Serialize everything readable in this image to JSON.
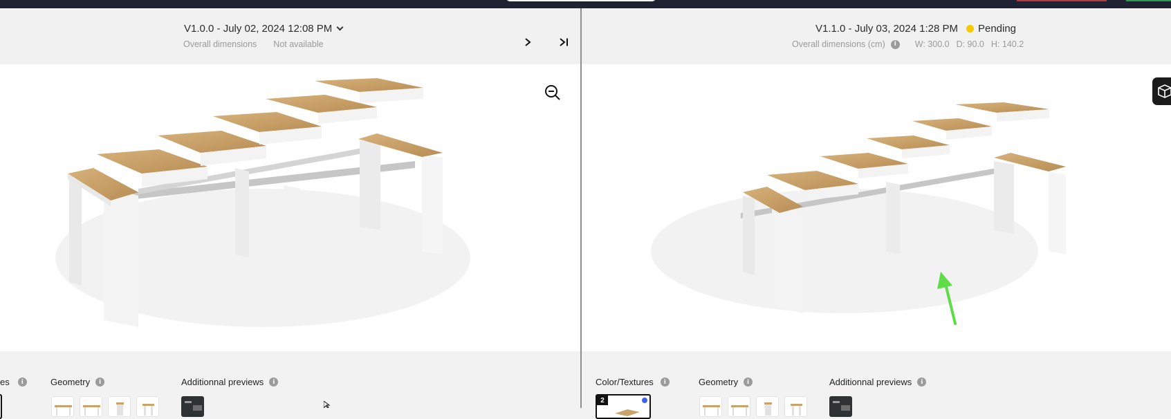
{
  "left": {
    "version_label": "V1.0.0 - July 02, 2024 12:08 PM",
    "dimensions_label": "Overall dimensions",
    "dimensions_value": "Not available",
    "sections": {
      "color_textures_partial": "es",
      "geometry": "Geometry",
      "additional_previews": "Additionnal previews"
    }
  },
  "right": {
    "version_label": "V1.1.0 - July 03, 2024 1:28 PM",
    "status": "Pending",
    "status_color": "#f7c900",
    "dimensions_label": "Overall dimensions (cm)",
    "width": "W: 300.0",
    "depth": "D: 90.0",
    "height": "H: 140.2",
    "sections": {
      "color_textures": "Color/Textures",
      "geometry": "Geometry",
      "additional_previews": "Additionnal previews"
    },
    "selected_texture_badge": "2"
  },
  "icons": {
    "next": "chevron-right-icon",
    "last": "skip-to-end-icon",
    "zoom": "zoom-out-icon",
    "cube": "cube-icon",
    "info": "info-icon"
  },
  "colors": {
    "topbar": "#1f2233",
    "oak": "#c9a46a",
    "white_body": "#f4f4f4",
    "arrow_annotation": "#5fdc48",
    "selection_dot": "#3b64f2"
  }
}
